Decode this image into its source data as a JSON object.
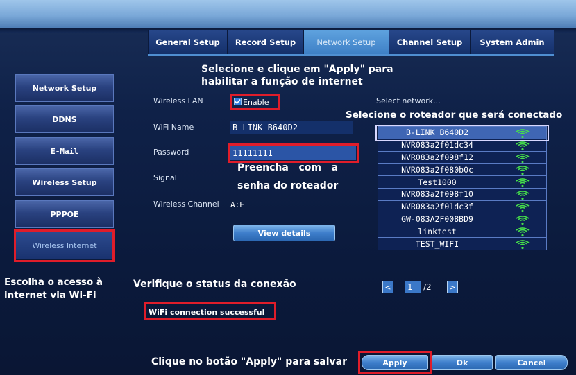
{
  "tabs": [
    {
      "label": "General Setup"
    },
    {
      "label": "Record Setup"
    },
    {
      "label": "Network Setup"
    },
    {
      "label": "Channel Setup"
    },
    {
      "label": "System Admin"
    }
  ],
  "sidebar": {
    "items": [
      {
        "label": "Network Setup"
      },
      {
        "label": "DDNS"
      },
      {
        "label": "E-Mail"
      },
      {
        "label": "Wireless Setup"
      },
      {
        "label": "PPPOE"
      },
      {
        "label": "Wireless Internet"
      }
    ]
  },
  "form": {
    "wireless_lan_label": "Wireless LAN",
    "enable_label": "Enable",
    "enable_checked": true,
    "wifi_name_label": "WiFi Name",
    "wifi_name_value": "B-LINK_B640D2",
    "password_label": "Password",
    "password_value": "11111111",
    "signal_label": "Signal",
    "wireless_channel_label": "Wireless Channel",
    "wireless_channel_value": "A:E",
    "view_details_label": "View details",
    "status_text": "WiFi connection successful"
  },
  "networks": {
    "header": "Select network...",
    "items": [
      {
        "name": "B-LINK_B640D2",
        "selected": true
      },
      {
        "name": "NVR083a2f01dc34"
      },
      {
        "name": "NVR083a2f098f12"
      },
      {
        "name": "NVR083a2f080b0c"
      },
      {
        "name": "Test1000"
      },
      {
        "name": "NVR083a2f098f10"
      },
      {
        "name": "NVR083a2f01dc3f"
      },
      {
        "name": "GW-083A2F008BD9"
      },
      {
        "name": "linktest"
      },
      {
        "name": "TEST_WIFI"
      }
    ],
    "page_current": "1",
    "page_total": "/2",
    "prev_icon": "<",
    "next_icon": ">"
  },
  "buttons": {
    "apply": "Apply",
    "ok": "Ok",
    "cancel": "Cancel"
  },
  "annotations": {
    "enable_hint": "Selecione e clique em \"Apply\" para habilitar a função de internet",
    "select_router_hint": "Selecione o roteador que será conectado",
    "password_hint_line1": "Preencha   com   a",
    "password_hint_line2": "senha do roteador",
    "wifi_access_hint_line1": "Escolha o acesso à",
    "wifi_access_hint_line2": "internet via Wi-Fi",
    "status_hint": "Verifique o status da conexão",
    "apply_hint": "Clique no botão \"Apply\" para salvar"
  },
  "colors": {
    "highlight_box": "#e01d2a",
    "wifi_icon": "#46e04a",
    "active_tab": "#3e80c6"
  }
}
